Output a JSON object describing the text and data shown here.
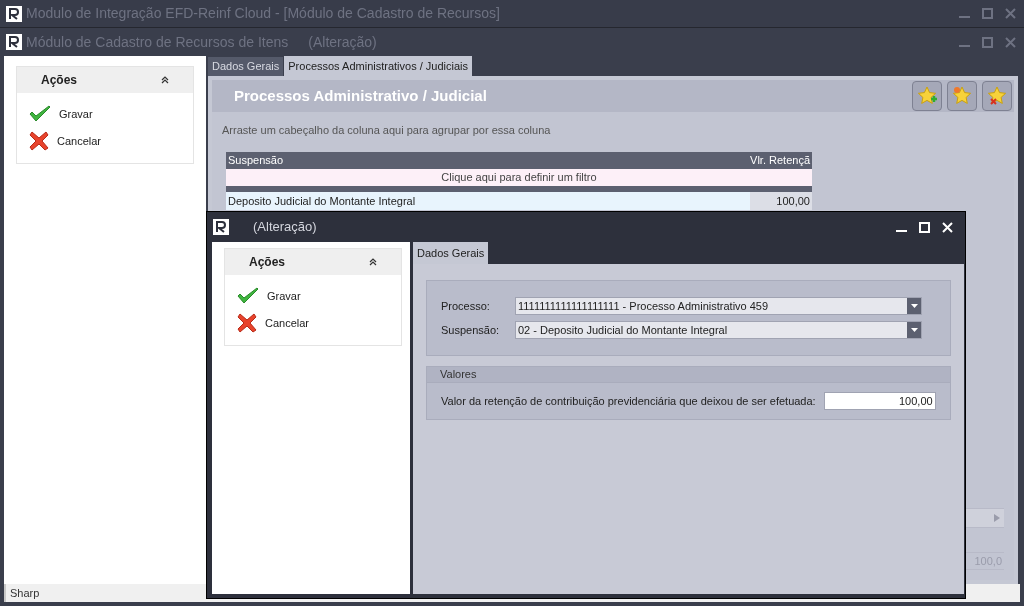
{
  "main_window": {
    "title": "Modulo de Integração EFD-Reinf Cloud - [Módulo de Cadastro de Recursos]"
  },
  "child_window": {
    "title": "Módulo de Cadastro de Recursos de Itens",
    "subtitle": "(Alteração)"
  },
  "actions_panel": {
    "title": "Ações",
    "items": [
      {
        "kind": "save",
        "label": "Gravar"
      },
      {
        "kind": "cancel",
        "label": "Cancelar"
      }
    ]
  },
  "tabs": [
    {
      "label": "Dados Gerais",
      "selected": false
    },
    {
      "label": "Processos Administrativos / Judiciais",
      "selected": true
    }
  ],
  "section_title": "Processos Administrativo / Judicial",
  "toolbar_buttons": [
    {
      "kind": "add"
    },
    {
      "kind": "edit"
    },
    {
      "kind": "delete"
    }
  ],
  "group_hint": "Arraste um cabeçalho da coluna aqui para agrupar por essa coluna",
  "grid": {
    "columns": [
      "Suspensão",
      "Vlr. Retençã"
    ],
    "filter_row": "Clique aqui para definir um filtro",
    "rows": [
      {
        "cells": [
          "Deposito Judicial do Montante Integral",
          "100,00"
        ],
        "selected": true
      }
    ],
    "footer_value": "100,0"
  },
  "status_bar": "Sharp",
  "dialog": {
    "title": "(Alteração)",
    "actions_panel": {
      "title": "Ações",
      "items": [
        {
          "kind": "save",
          "label": "Gravar"
        },
        {
          "kind": "cancel",
          "label": "Cancelar"
        }
      ]
    },
    "tabs": [
      {
        "label": "Dados Gerais",
        "selected": true
      }
    ],
    "fields": [
      {
        "label": "Processo:",
        "value": "1111111111111111111 - Processo Administrativo 459"
      },
      {
        "label": "Suspensão:",
        "value": "02 - Deposito Judicial do Montante Integral"
      }
    ],
    "values_group": {
      "title": "Valores",
      "fields": [
        {
          "label": "Valor da retenção de contribuição previdenciária que deixou de ser efetuada:",
          "value": "100,00"
        }
      ]
    }
  }
}
